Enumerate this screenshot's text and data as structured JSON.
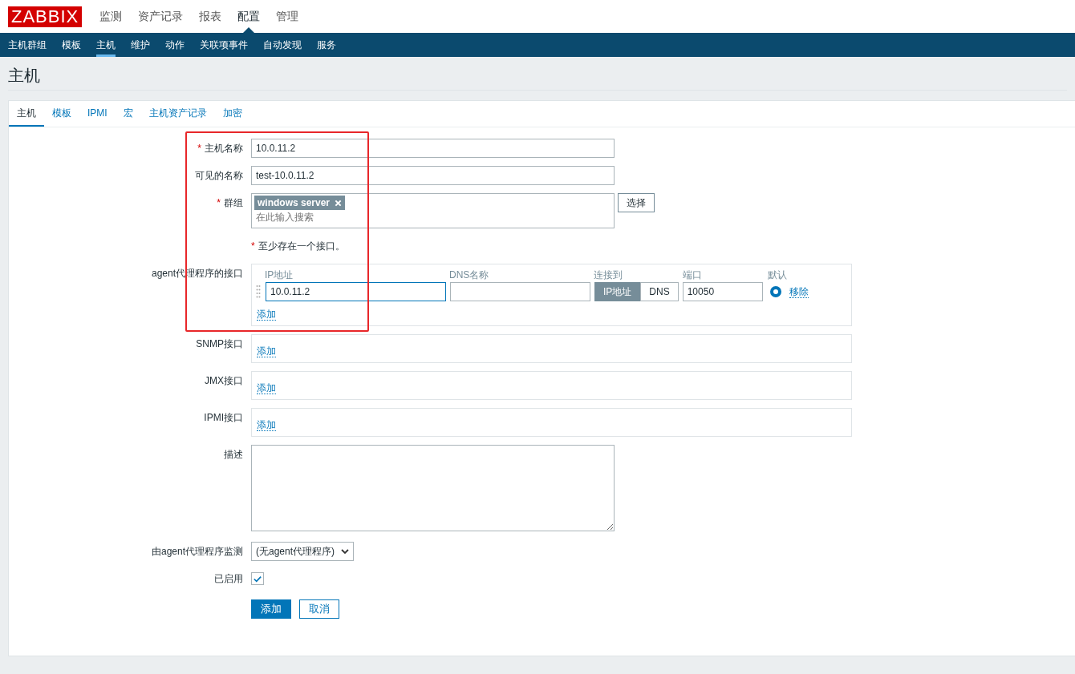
{
  "header": {
    "logo": "ZABBIX",
    "main_menu": [
      {
        "label": "监测",
        "selected": false
      },
      {
        "label": "资产记录",
        "selected": false
      },
      {
        "label": "报表",
        "selected": false
      },
      {
        "label": "配置",
        "selected": true
      },
      {
        "label": "管理",
        "selected": false
      }
    ],
    "sub_menu": [
      {
        "label": "主机群组",
        "selected": false
      },
      {
        "label": "模板",
        "selected": false
      },
      {
        "label": "主机",
        "selected": true
      },
      {
        "label": "维护",
        "selected": false
      },
      {
        "label": "动作",
        "selected": false
      },
      {
        "label": "关联项事件",
        "selected": false
      },
      {
        "label": "自动发现",
        "selected": false
      },
      {
        "label": "服务",
        "selected": false
      }
    ]
  },
  "page_title": "主机",
  "tabs": [
    {
      "label": "主机",
      "selected": true
    },
    {
      "label": "模板",
      "selected": false
    },
    {
      "label": "IPMI",
      "selected": false
    },
    {
      "label": "宏",
      "selected": false
    },
    {
      "label": "主机资产记录",
      "selected": false
    },
    {
      "label": "加密",
      "selected": false
    }
  ],
  "form": {
    "host_name": {
      "label": "主机名称",
      "required_mark": "*",
      "value": "10.0.11.2"
    },
    "visible_name": {
      "label": "可见的名称",
      "value": "test-10.0.11.2"
    },
    "groups": {
      "label": "群组",
      "required_mark": "*",
      "tags": [
        {
          "label": "windows server"
        }
      ],
      "placeholder": "在此输入搜索",
      "select_button": "选择"
    },
    "interface_note": {
      "required_mark": "*",
      "text": "至少存在一个接口。"
    },
    "interfaces": [
      {
        "label": "agent代理程序的接口",
        "columns": [
          "IP地址",
          "DNS名称",
          "连接到",
          "端口",
          "默认"
        ],
        "rows": [
          {
            "ip": "10.0.11.2",
            "connect_options": [
              {
                "label": "IP地址",
                "selected": true
              },
              {
                "label": "DNS",
                "selected": false
              }
            ],
            "port": "10050",
            "default": true,
            "remove": "移除"
          }
        ],
        "add": "添加"
      },
      {
        "label": "SNMP接口",
        "add": "添加"
      },
      {
        "label": "JMX接口",
        "add": "添加"
      },
      {
        "label": "IPMI接口",
        "add": "添加"
      }
    ],
    "description": {
      "label": "描述"
    },
    "proxy": {
      "label": "由agent代理程序监测",
      "value": "(无agent代理程序)"
    },
    "enabled": {
      "label": "已启用",
      "checked": true
    },
    "buttons": [
      {
        "label": "添加",
        "kind": "primary"
      },
      {
        "label": "取消",
        "kind": "secondary"
      }
    ]
  }
}
